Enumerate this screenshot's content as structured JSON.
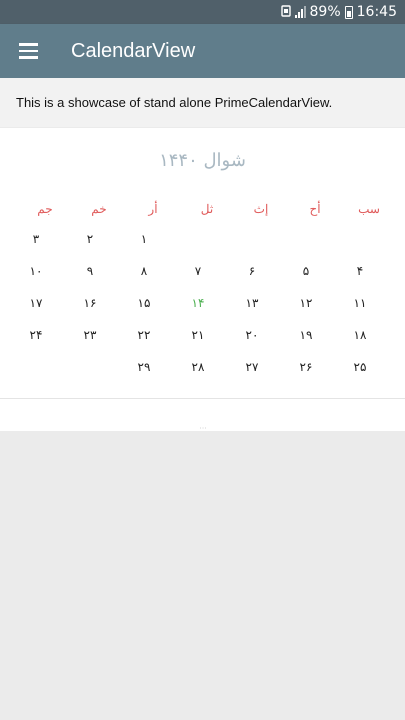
{
  "status_bar": {
    "battery_text": "89%",
    "time": "16:45",
    "icons": [
      "notification-icon",
      "signal-icon",
      "battery-icon"
    ]
  },
  "app_bar": {
    "title": "CalendarView",
    "menu_icon": "menu-icon",
    "background": "#607d8b"
  },
  "description": "This is a showcase of stand alone PrimeCalendarView.",
  "calendar": {
    "month_title": "شوال ۱۴۴۰",
    "weekdays": [
      "سب",
      "أح",
      "إث",
      "ثل",
      "أر",
      "خم",
      "جم"
    ],
    "weeks": [
      [
        "",
        "",
        "",
        "",
        "۱",
        "۲",
        "۳"
      ],
      [
        "۴",
        "۵",
        "۶",
        "۷",
        "۸",
        "۹",
        "۱۰"
      ],
      [
        "۱۱",
        "۱۲",
        "۱۳",
        "۱۴",
        "۱۵",
        "۱۶",
        "۱۷"
      ],
      [
        "۱۸",
        "۱۹",
        "۲۰",
        "۲۱",
        "۲۲",
        "۲۳",
        "۲۴"
      ],
      [
        "۲۵",
        "۲۶",
        "۲۷",
        "۲۸",
        "۲۹",
        "",
        ""
      ]
    ],
    "today": "۱۴",
    "colors": {
      "weekday": "#e05a5a",
      "today": "#4caf50",
      "title": "#a9b8c2"
    }
  }
}
